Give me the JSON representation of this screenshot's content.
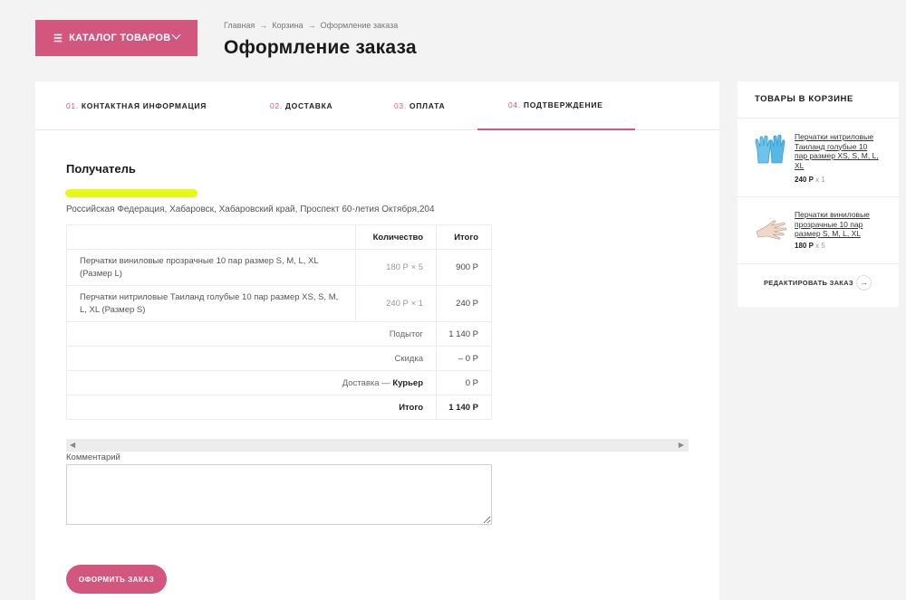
{
  "header": {
    "catalog_label": "КАТАЛОГ ТОВАРОВ",
    "breadcrumb": [
      "Главная",
      "Корзина",
      "Оформление заказа"
    ],
    "breadcrumb_sep": "→",
    "title": "Оформление заказа"
  },
  "steps": [
    {
      "num": "01.",
      "label": "КОНТАКТНАЯ ИНФОРМАЦИЯ",
      "active": false
    },
    {
      "num": "02.",
      "label": "ДОСТАВКА",
      "active": false
    },
    {
      "num": "03.",
      "label": "ОПЛАТА",
      "active": false
    },
    {
      "num": "04.",
      "label": "ПОДТВЕРЖДЕНИЕ",
      "active": true
    }
  ],
  "recipient": {
    "title": "Получатель",
    "name_redacted": "",
    "address": "Российская Федерация, Хабаровск, Хабаровский край, Проспект 60-летия Октября,204"
  },
  "order_table": {
    "headers": [
      "Количество",
      "Итого"
    ],
    "rows": [
      {
        "name": "Перчатки виниловые прозрачные 10 пар размер S, M, L, XL (Размер L)",
        "qty": "180 Р × 5",
        "total": "900 Р"
      },
      {
        "name": "Перчатки нитриловые Таиланд голубые 10 пар размер XS, S, M, L, XL (Размер S)",
        "qty": "240 Р × 1",
        "total": "240 Р"
      }
    ],
    "subtotal_label": "Подытог",
    "subtotal": "1 140 Р",
    "discount_label": "Скидка",
    "discount": "– 0 Р",
    "delivery_label": "Доставка —",
    "delivery_method": "Курьер",
    "delivery": "0 Р",
    "total_label": "Итого",
    "total": "1 140 Р"
  },
  "comment": {
    "label": "Комментарий",
    "value": ""
  },
  "submit_label": "ОФОРМИТЬ ЗАКАЗ",
  "cart": {
    "title": "ТОВАРЫ В КОРЗИНЕ",
    "items": [
      {
        "name": "Перчатки нитриловые Таиланд голубые 10 пар размер XS, S, M, L, XL",
        "price": "240 Р",
        "qty": "x 1",
        "icon": "blue-gloves-icon"
      },
      {
        "name": "Перчатки виниловые прозрачные 10 пар размер S, M, L, XL",
        "price": "180 Р",
        "qty": "x 5",
        "icon": "clear-glove-icon"
      }
    ],
    "edit_label": "РЕДАКТИРОВАТЬ ЗАКАЗ",
    "edit_arrow": "→"
  },
  "colors": {
    "accent": "#d3567e",
    "background": "#f3f3f3",
    "highlight": "#e6f914"
  }
}
